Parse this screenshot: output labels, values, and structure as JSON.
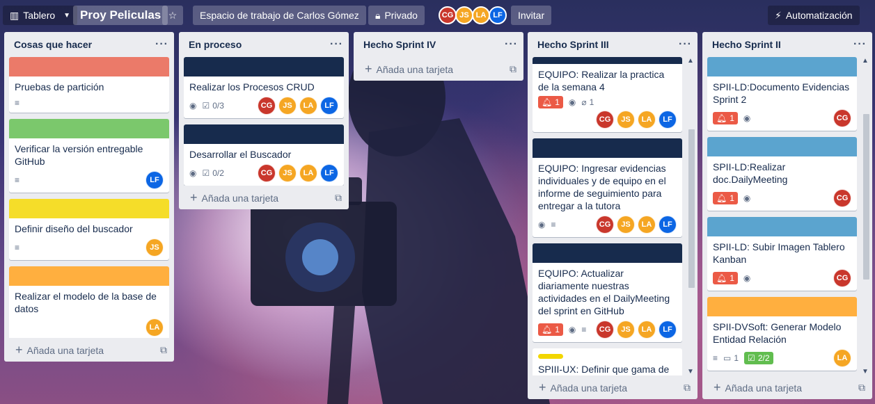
{
  "header": {
    "board_button": "Tablero",
    "board_name": "Proy Peliculas",
    "workspace": "Espacio de trabajo de Carlos Gómez",
    "visibility": "Privado",
    "members": [
      "CG",
      "JS",
      "LA",
      "LF"
    ],
    "invite": "Invitar",
    "automation": "Automatización"
  },
  "add_card_label": "Añada una tarjeta",
  "colors": {
    "red": "#eb5a46",
    "green": "#61bd4f",
    "yellow": "#f2d600",
    "orange": "#ffab4a",
    "navy": "#172b4d",
    "blue": "#5ba4cf"
  },
  "lists": [
    {
      "title": "Cosas que hacer",
      "cards": [
        {
          "title": "Pruebas de partición"
        },
        {
          "title": "Verificar la versión entregable GitHub",
          "member": "LF"
        },
        {
          "title": "Definir diseño del buscador",
          "member": "JS"
        },
        {
          "title": "Realizar el modelo de la base de datos",
          "member": "LA"
        }
      ]
    },
    {
      "title": "En proceso",
      "cards": [
        {
          "title": "Realizar los Procesos CRUD",
          "checklist": "0/3",
          "members": [
            "CG",
            "JS",
            "LA",
            "LF"
          ]
        },
        {
          "title": "Desarrollar el Buscador",
          "checklist": "0/2",
          "members": [
            "CG",
            "JS",
            "LA",
            "LF"
          ]
        }
      ]
    },
    {
      "title": "Hecho Sprint IV",
      "cards": []
    },
    {
      "title": "Hecho Sprint III",
      "cards": [
        {
          "title": "EQUIPO: Realizar la practica de la semana 4",
          "notifications": "1",
          "attachments": "1",
          "members": [
            "CG",
            "JS",
            "LA",
            "LF"
          ]
        },
        {
          "title": "EQUIPO: Ingresar evidencias individuales y de equipo en el informe de seguimiento para entregar a la tutora",
          "members": [
            "CG",
            "JS",
            "LA",
            "LF"
          ]
        },
        {
          "title": "EQUIPO: Actualizar diariamente nuestras actividades en el DailyMeeting del sprint en GitHub",
          "notifications": "1",
          "members": [
            "CG",
            "JS",
            "LA",
            "LF"
          ]
        },
        {
          "title": "SPIII-UX: Definir que gama de colores vamos a usar en la interfaz"
        }
      ]
    },
    {
      "title": "Hecho Sprint II",
      "cards": [
        {
          "title": "SPII-LD:Documento Evidencias Sprint 2",
          "notifications": "1",
          "member": "CG"
        },
        {
          "title": "SPII-LD:Realizar doc.DailyMeeting",
          "notifications": "1",
          "member": "CG"
        },
        {
          "title": "SPII-LD: Subir Imagen Tablero Kanban",
          "notifications": "1",
          "member": "CG"
        },
        {
          "title": "SPII-DVSoft: Generar Modelo Entidad Relación",
          "comments": "1",
          "checklist": "2/2",
          "member": "LA"
        }
      ]
    }
  ]
}
